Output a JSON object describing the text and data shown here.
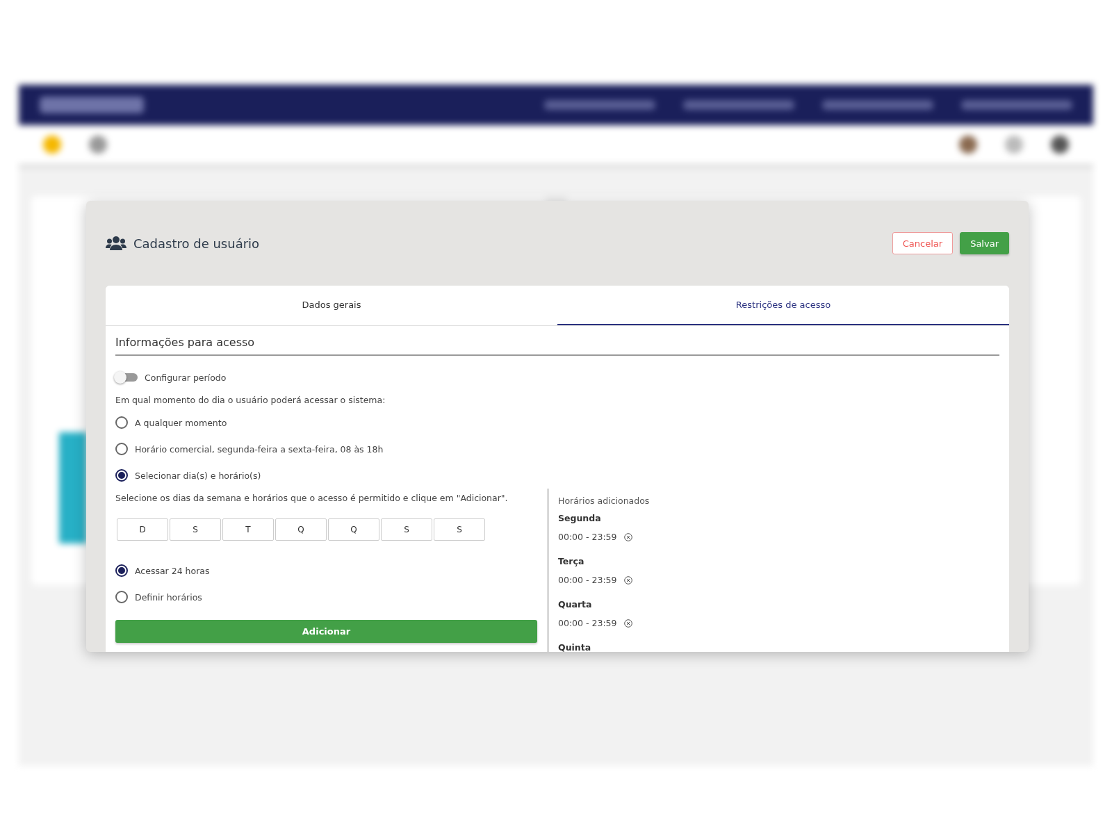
{
  "modal": {
    "title": "Cadastro de usuário",
    "buttons": [
      {
        "label": "Cancelar",
        "kind": "outline"
      },
      {
        "label": "Salvar",
        "kind": "primary"
      }
    ],
    "tabs": [
      {
        "label": "Dados gerais",
        "selected": false
      },
      {
        "label": "Restrições de acesso",
        "selected": true
      }
    ],
    "section_title": "Informações para acesso",
    "period_toggle": {
      "label": "Configurar período",
      "on": false
    },
    "question": "Em qual momento do dia o usuário poderá acessar o sistema:",
    "access_options": [
      {
        "label": "A qualquer momento",
        "selected": false
      },
      {
        "label": "Horário comercial, segunda-feira a sexta-feira, 08 às 18h",
        "selected": false
      },
      {
        "label": "Selecionar dia(s) e horário(s)",
        "selected": true
      }
    ],
    "instructions": "Selecione os dias da semana e horários que o acesso é permitido e clique em \"Adicionar\".",
    "days": [
      {
        "label": "D",
        "selected": false
      },
      {
        "label": "S",
        "selected": false
      },
      {
        "label": "T",
        "selected": false
      },
      {
        "label": "Q",
        "selected": false
      },
      {
        "label": "Q",
        "selected": false
      },
      {
        "label": "S",
        "selected": false
      },
      {
        "label": "S",
        "selected": false
      }
    ],
    "hours_options": [
      {
        "label": "Acessar 24 horas",
        "selected": true
      },
      {
        "label": "Definir horários",
        "selected": false
      }
    ],
    "add_button": "Adicionar",
    "added": {
      "title": "Horários adicionados",
      "days": [
        {
          "day": "Segunda",
          "ranges": [
            "00:00 - 23:59"
          ]
        },
        {
          "day": "Terça",
          "ranges": [
            "00:00 - 23:59"
          ]
        },
        {
          "day": "Quarta",
          "ranges": [
            "00:00 - 23:59"
          ]
        },
        {
          "day": "Quinta"
        }
      ]
    }
  }
}
